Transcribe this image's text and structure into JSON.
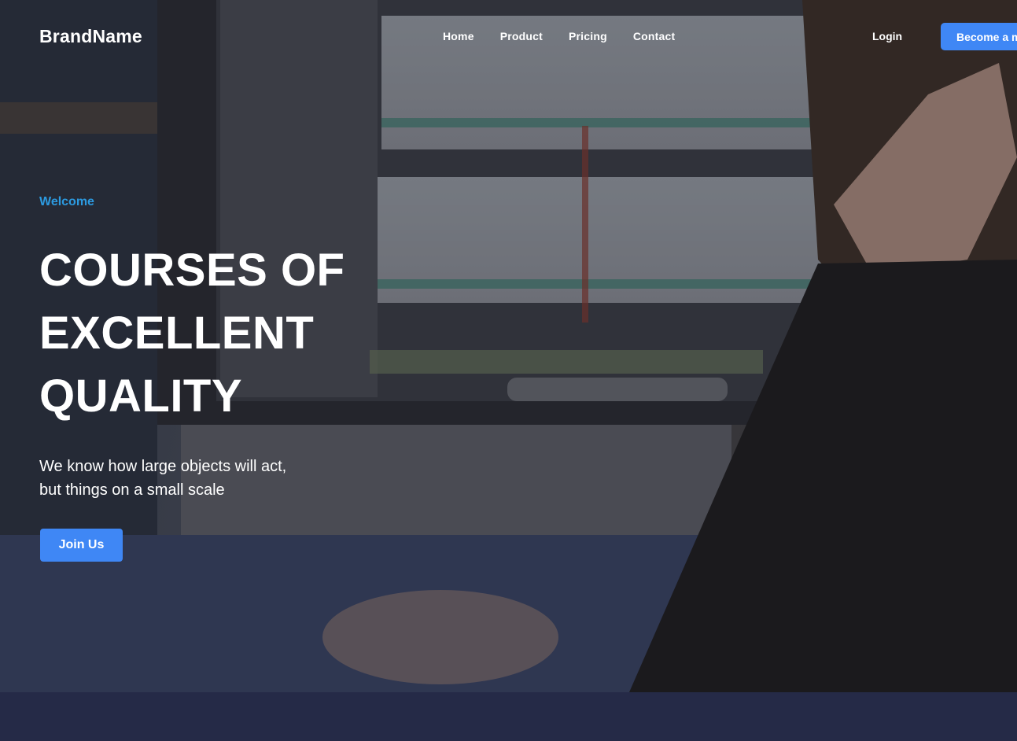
{
  "header": {
    "brand": "BrandName",
    "nav": [
      "Home",
      "Product",
      "Pricing",
      "Contact"
    ],
    "login": "Login",
    "cta": "Become a member"
  },
  "hero": {
    "eyebrow": "Welcome",
    "headline": [
      "COURSES OF",
      "EXCELLENT",
      "QUALITY"
    ],
    "subtitle": [
      "We know how large objects will act,",
      "but things on a small scale"
    ],
    "button": "Join Us",
    "accent_color": "#3f87f5",
    "eyebrow_color": "#2c9ae0"
  },
  "footer": {
    "background": "#252a47"
  }
}
